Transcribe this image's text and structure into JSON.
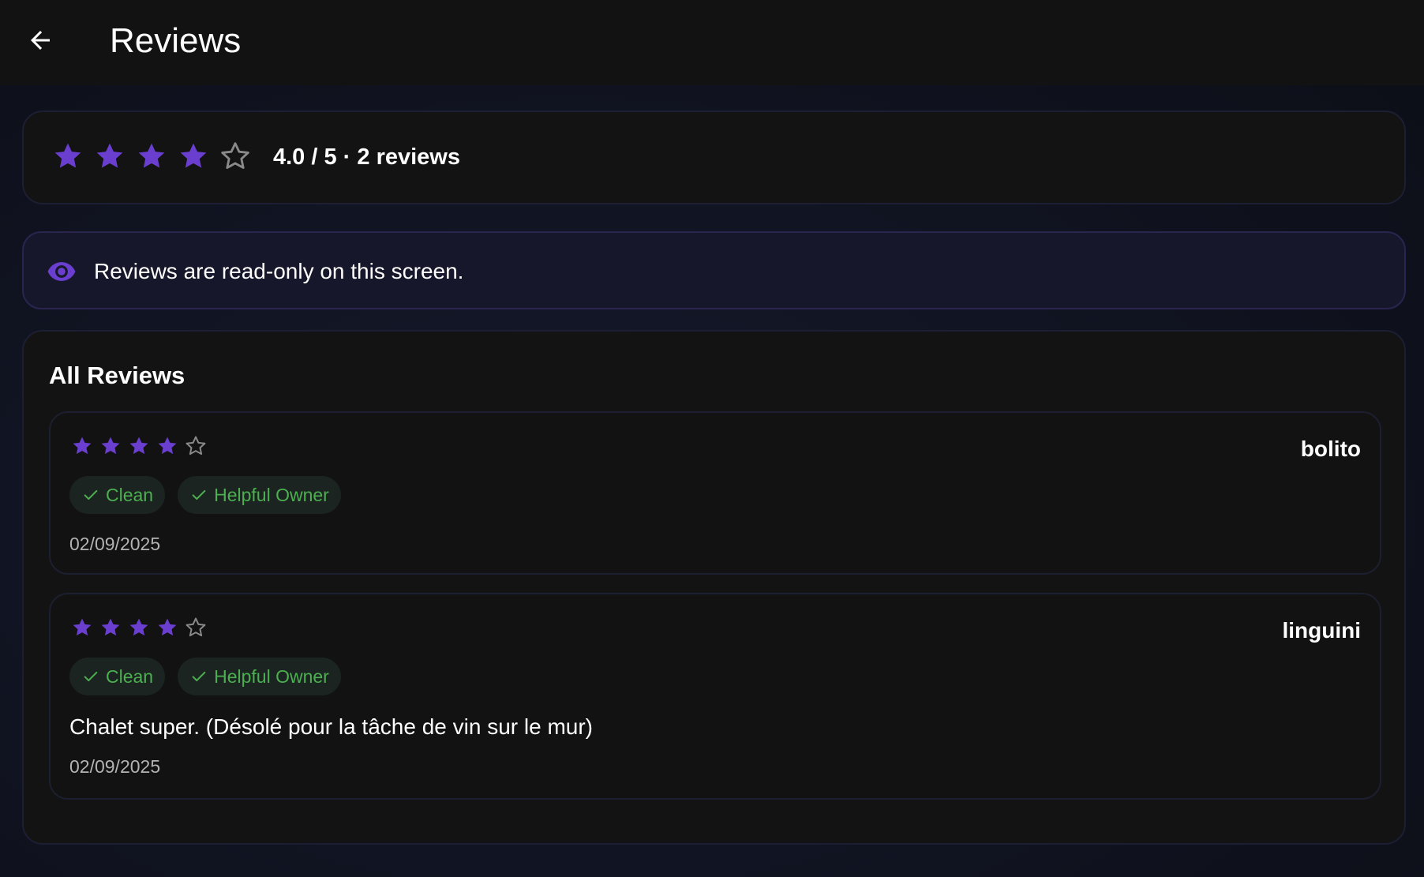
{
  "colors": {
    "accent": "#6a3fd0",
    "tag_text": "#4caf50",
    "tag_bg": "#1b2420",
    "star_empty": "#8a8a8a"
  },
  "header": {
    "title": "Reviews",
    "back_icon": "arrow-left-icon"
  },
  "summary": {
    "rating": 4,
    "max_rating": 5,
    "text": "4.0 / 5 · 2 reviews"
  },
  "info_banner": {
    "icon": "eye-icon",
    "text": "Reviews are read-only on this screen."
  },
  "reviews_section": {
    "title": "All Reviews",
    "reviews": [
      {
        "author": "bolito",
        "rating": 4,
        "tags": [
          "Clean",
          "Helpful Owner"
        ],
        "comment": "",
        "date": "02/09/2025"
      },
      {
        "author": "linguini",
        "rating": 4,
        "tags": [
          "Clean",
          "Helpful Owner"
        ],
        "comment": "Chalet super. (Désolé pour la tâche de vin sur le mur)",
        "date": "02/09/2025"
      }
    ]
  }
}
